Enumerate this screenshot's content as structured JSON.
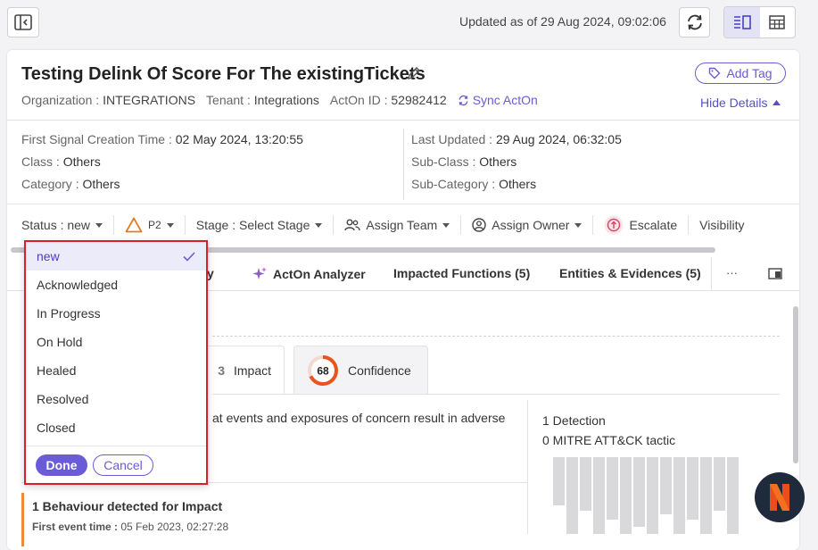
{
  "header": {
    "updated_text": "Updated as of 29 Aug 2024, 09:02:06"
  },
  "ticket": {
    "title": "Testing Delink Of Score For The existingTickets",
    "organization_label": "Organization :",
    "organization": "INTEGRATIONS",
    "tenant_label": "Tenant :",
    "tenant": "Integrations",
    "acton_label": "ActOn ID :",
    "acton_id": "52982412",
    "sync_label": "Sync ActOn",
    "add_tag": "Add Tag",
    "hide_details": "Hide Details"
  },
  "details": {
    "left": [
      {
        "k": "First Signal Creation Time :",
        "v": "02 May 2024, 13:20:55"
      },
      {
        "k": "Class :",
        "v": "Others"
      },
      {
        "k": "Category :",
        "v": "Others"
      }
    ],
    "right": [
      {
        "k": "Last Updated :",
        "v": "29 Aug 2024, 06:32:05"
      },
      {
        "k": "Sub-Class :",
        "v": "Others"
      },
      {
        "k": "Sub-Category :",
        "v": "Others"
      }
    ]
  },
  "statusbar": {
    "status": "Status : new",
    "priority": "P2",
    "stage": "Stage : Select Stage",
    "assign_team": "Assign Team",
    "assign_owner": "Assign Owner",
    "escalate": "Escalate",
    "visibility": "Visibility"
  },
  "tabs": {
    "partial": "y",
    "acton_analyzer": "ActOn Analyzer",
    "impacted_functions": "Impacted Functions (5)",
    "entities": "Entities & Evidences (5)",
    "more": "···"
  },
  "scores": {
    "impact_label": "Impact",
    "impact_partial_value": "3",
    "confidence_value": "68",
    "confidence_label": "Confidence",
    "confidence_fraction": 0.68
  },
  "summary": {
    "description": "at events and exposures of concern result in adverse",
    "detections": "1 Detection",
    "mitre": "0 MITRE ATT&CK tactic"
  },
  "behaviour": {
    "heading": "1 Behaviour detected for Impact",
    "first_event_label": "First event time :",
    "first_event_value": "05 Feb 2023, 02:27:28"
  },
  "dropdown": {
    "items": [
      "new",
      "Acknowledged",
      "In Progress",
      "On Hold",
      "Healed",
      "Resolved",
      "Closed"
    ],
    "selected": "new",
    "done": "Done",
    "cancel": "Cancel"
  },
  "colors": {
    "accent": "#6a5bd6",
    "highlight_border": "#d9202a",
    "priority": "#e27c1f",
    "confidence_ring": "#e8541e"
  }
}
